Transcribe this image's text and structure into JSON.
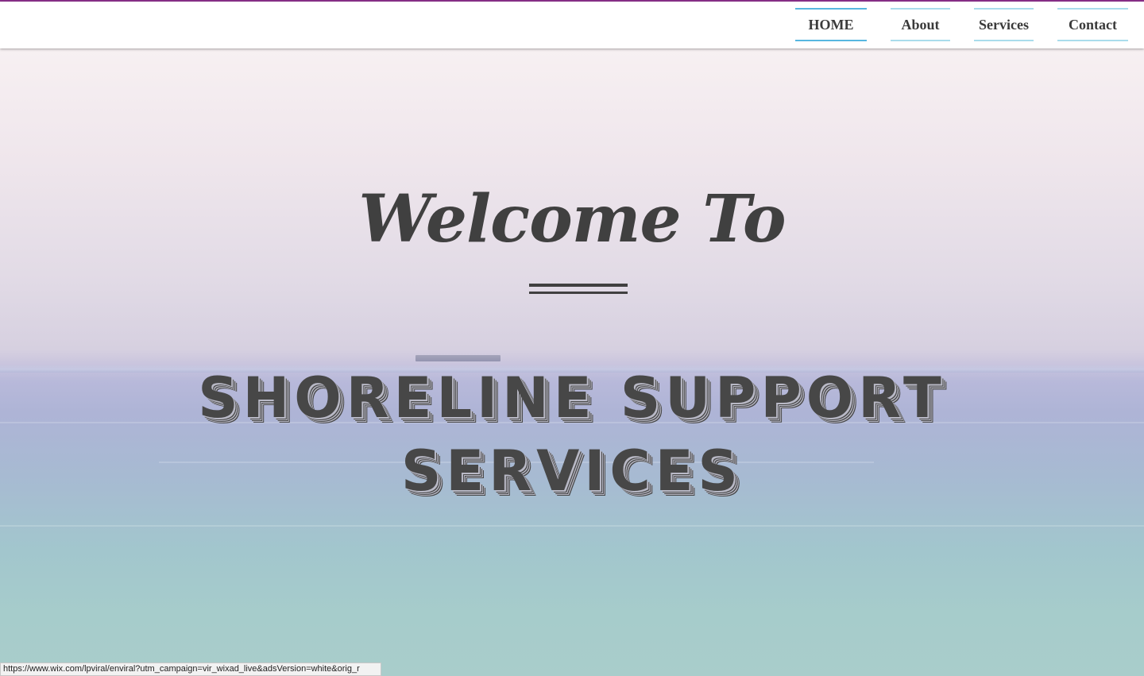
{
  "nav": {
    "items": [
      {
        "label": "HOME",
        "active": true
      },
      {
        "label": "About",
        "active": false
      },
      {
        "label": "Services",
        "active": false
      },
      {
        "label": "Contact",
        "active": false
      }
    ]
  },
  "hero": {
    "welcome": "Welcome To",
    "title_line1": "SHORELINE SUPPORT",
    "title_line2": "SERVICES"
  },
  "status_bar": {
    "url": "https://www.wix.com/lpviral/enviral?utm_campaign=vir_wixad_live&adsVersion=white&orig_r"
  },
  "colors": {
    "accent_top_line": "#8a2f8a",
    "nav_active_border": "#57b7e0",
    "nav_border": "#a9dcec",
    "text_dark": "#404040"
  }
}
